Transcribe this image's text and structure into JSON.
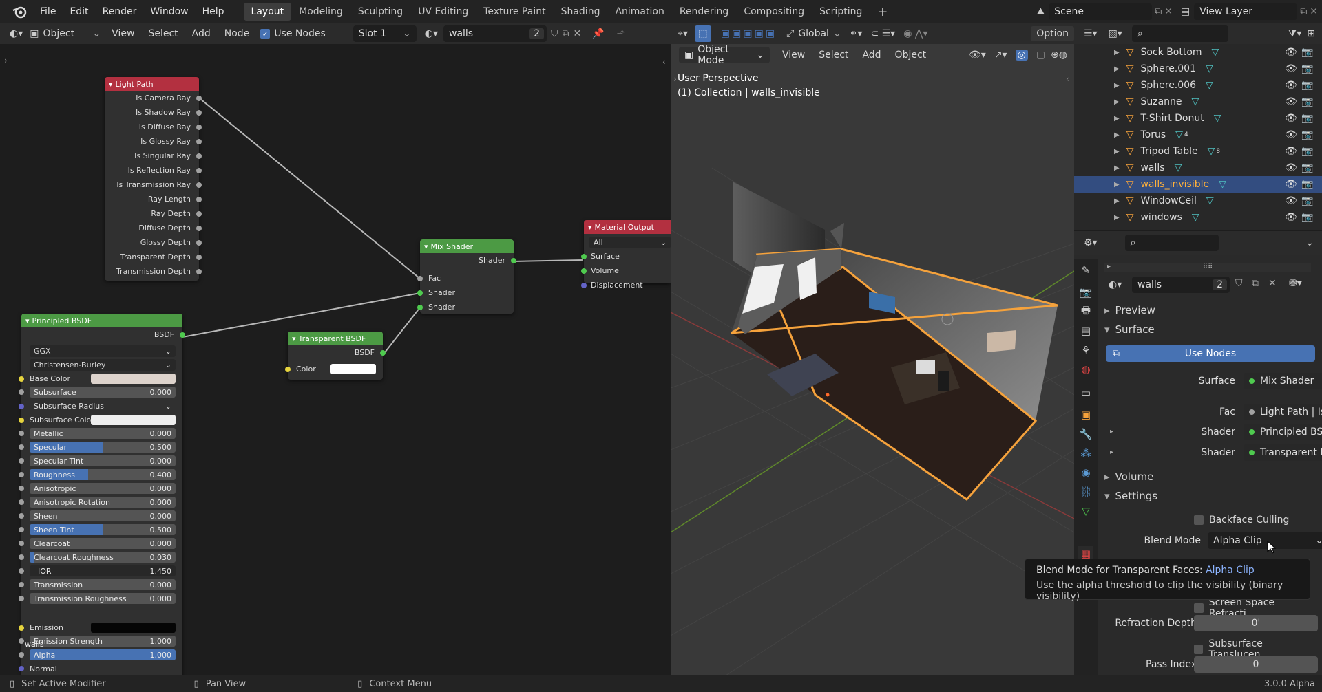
{
  "topbar": {
    "menus": [
      "File",
      "Edit",
      "Render",
      "Window",
      "Help"
    ],
    "workspaces": [
      "Layout",
      "Modeling",
      "Sculpting",
      "UV Editing",
      "Texture Paint",
      "Shading",
      "Animation",
      "Rendering",
      "Compositing",
      "Scripting"
    ],
    "active_workspace": "Layout",
    "add_tab": "+",
    "scene": "Scene",
    "view_layer": "View Layer"
  },
  "node_editor": {
    "header": {
      "object_label": "Object",
      "menus": [
        "View",
        "Select",
        "Add",
        "Node"
      ],
      "use_nodes": "Use Nodes",
      "slot": "Slot 1",
      "material": "walls",
      "users": "2"
    },
    "light_path": {
      "title": "Light Path",
      "outputs": [
        "Is Camera Ray",
        "Is Shadow Ray",
        "Is Diffuse Ray",
        "Is Glossy Ray",
        "Is Singular Ray",
        "Is Reflection Ray",
        "Is Transmission Ray",
        "Ray Length",
        "Ray Depth",
        "Diffuse Depth",
        "Glossy Depth",
        "Transparent Depth",
        "Transmission Depth"
      ]
    },
    "mix_shader": {
      "title": "Mix Shader",
      "output": "Shader",
      "inputs": [
        "Fac",
        "Shader",
        "Shader"
      ]
    },
    "material_output": {
      "title": "Material Output",
      "target": "All",
      "inputs": [
        "Surface",
        "Volume",
        "Displacement"
      ]
    },
    "transparent": {
      "title": "Transparent BSDF",
      "output": "BSDF",
      "color_label": "Color"
    },
    "principled": {
      "title": "Principled BSDF",
      "output": "BSDF",
      "distribution": "GGX",
      "subsurface_method": "Christensen-Burley",
      "base_color_label": "Base Color",
      "subsurface_radius_label": "Subsurface Radius",
      "subsurface_color_label": "Subsurface Colo",
      "sliders": [
        {
          "label": "Subsurface",
          "value": "0.000",
          "fill": 0
        },
        {
          "label": "Metallic",
          "value": "0.000",
          "fill": 0
        },
        {
          "label": "Specular",
          "value": "0.500",
          "fill": 0.5
        },
        {
          "label": "Specular Tint",
          "value": "0.000",
          "fill": 0
        },
        {
          "label": "Roughness",
          "value": "0.400",
          "fill": 0.4
        },
        {
          "label": "Anisotropic",
          "value": "0.000",
          "fill": 0
        },
        {
          "label": "Anisotropic Rotation",
          "value": "0.000",
          "fill": 0
        },
        {
          "label": "Sheen",
          "value": "0.000",
          "fill": 0
        },
        {
          "label": "Sheen Tint",
          "value": "0.500",
          "fill": 0.5
        },
        {
          "label": "Clearcoat",
          "value": "0.000",
          "fill": 0
        },
        {
          "label": "Clearcoat Roughness",
          "value": "0.030",
          "fill": 0.03
        },
        {
          "label": "IOR",
          "value": "1.450",
          "fill": 0
        },
        {
          "label": "Transmission",
          "value": "0.000",
          "fill": 0
        },
        {
          "label": "Transmission Roughness",
          "value": "0.000",
          "fill": 0
        }
      ],
      "emission_label": "Emission",
      "emission_strength": {
        "label": "Emission Strength",
        "value": "1.000"
      },
      "alpha": {
        "label": "Alpha",
        "value": "1.000"
      },
      "normal_label": "Normal"
    },
    "overlay_label": "walls"
  },
  "viewport": {
    "mode": "Object Mode",
    "menus": [
      "View",
      "Select",
      "Add",
      "Object"
    ],
    "orientation": "Global",
    "options": "Option",
    "perspective": "User Perspective",
    "collection": "(1) Collection | walls_invisible"
  },
  "outliner": {
    "items": [
      {
        "name": "Sock Bottom",
        "selected": false
      },
      {
        "name": "Sphere.001",
        "selected": false
      },
      {
        "name": "Sphere.006",
        "selected": false
      },
      {
        "name": "Suzanne",
        "selected": false
      },
      {
        "name": "T-Shirt Donut",
        "selected": false
      },
      {
        "name": "Torus",
        "selected": false,
        "badge": "4"
      },
      {
        "name": "Tripod Table",
        "selected": false,
        "badge": "8"
      },
      {
        "name": "walls",
        "selected": false
      },
      {
        "name": "walls_invisible",
        "selected": true
      },
      {
        "name": "WindowCeil",
        "selected": false
      },
      {
        "name": "windows",
        "selected": false
      }
    ]
  },
  "properties": {
    "material": "walls",
    "users": "2",
    "preview": "Preview",
    "surface_section": "Surface",
    "use_nodes": "Use Nodes",
    "surface": {
      "label": "Surface",
      "value": "Mix Shader"
    },
    "fac": {
      "label": "Fac",
      "value": "Light Path | Is Came..."
    },
    "shader1": {
      "label": "Shader",
      "value": "Principled BSDF"
    },
    "shader2": {
      "label": "Shader",
      "value": "Transparent BSDF"
    },
    "volume_section": "Volume",
    "settings_section": "Settings",
    "backface": "Backface Culling",
    "blend_mode": {
      "label": "Blend Mode",
      "value": "Alpha Clip"
    },
    "screen_space": "Screen Space Refracti...",
    "refraction_depth": {
      "label": "Refraction Depth",
      "value": "0'"
    },
    "subsurface_translucency": "Subsurface Translucen...",
    "pass_index": {
      "label": "Pass Index",
      "value": "0"
    }
  },
  "tooltip": {
    "title": "Blend Mode for Transparent Faces:",
    "value": "Alpha Clip",
    "description": "Use the alpha threshold to clip the visibility (binary visibility)"
  },
  "statusbar": {
    "left": "Set Active Modifier",
    "middle": "Pan View",
    "right": "Context Menu",
    "version": "3.0.0 Alpha"
  },
  "colors": {
    "accent": "#4772b3",
    "selection_orange": "#f5a23c",
    "shader_green": "#4c9a44",
    "output_red": "#b33040",
    "input_red": "#b33040"
  }
}
